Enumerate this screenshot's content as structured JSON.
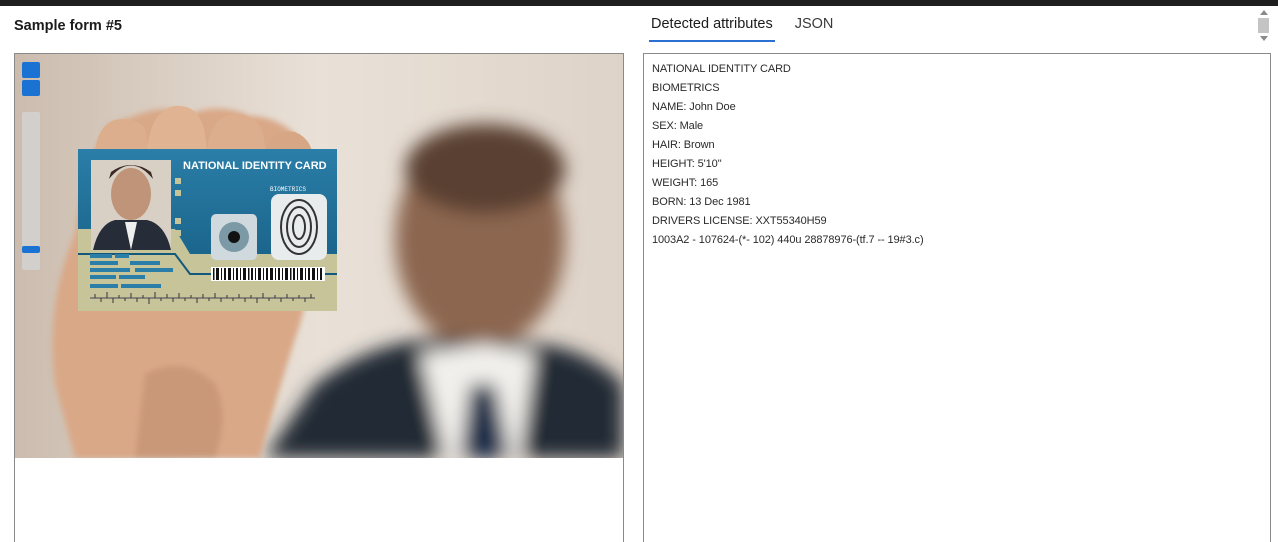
{
  "form": {
    "title": "Sample form #5"
  },
  "tabs": [
    {
      "label": "Detected attributes",
      "active": true
    },
    {
      "label": "JSON",
      "active": false
    }
  ],
  "card": {
    "title": "NATIONAL IDENTITY CARD",
    "biometrics_label": "BIOMETRICS"
  },
  "attributes": [
    "NATIONAL IDENTITY CARD",
    "BIOMETRICS",
    "NAME: John Doe",
    "SEX: Male",
    "HAIR: Brown",
    "HEIGHT: 5'10\"",
    "WEIGHT: 165",
    "BORN: 13 Dec 1981",
    "DRIVERS LICENSE: XXT55340H59",
    "1003A2 - 107624-(*- 102) 440u 28878976-(tf.7 -- 19#3.c)"
  ],
  "colors": {
    "accent": "#1a73d2",
    "card_blue": "#1d6a93",
    "card_beige": "#c8c49a"
  },
  "icons": [
    "zoom-in-icon",
    "zoom-out-icon",
    "scroll-up-icon",
    "scroll-down-icon"
  ]
}
